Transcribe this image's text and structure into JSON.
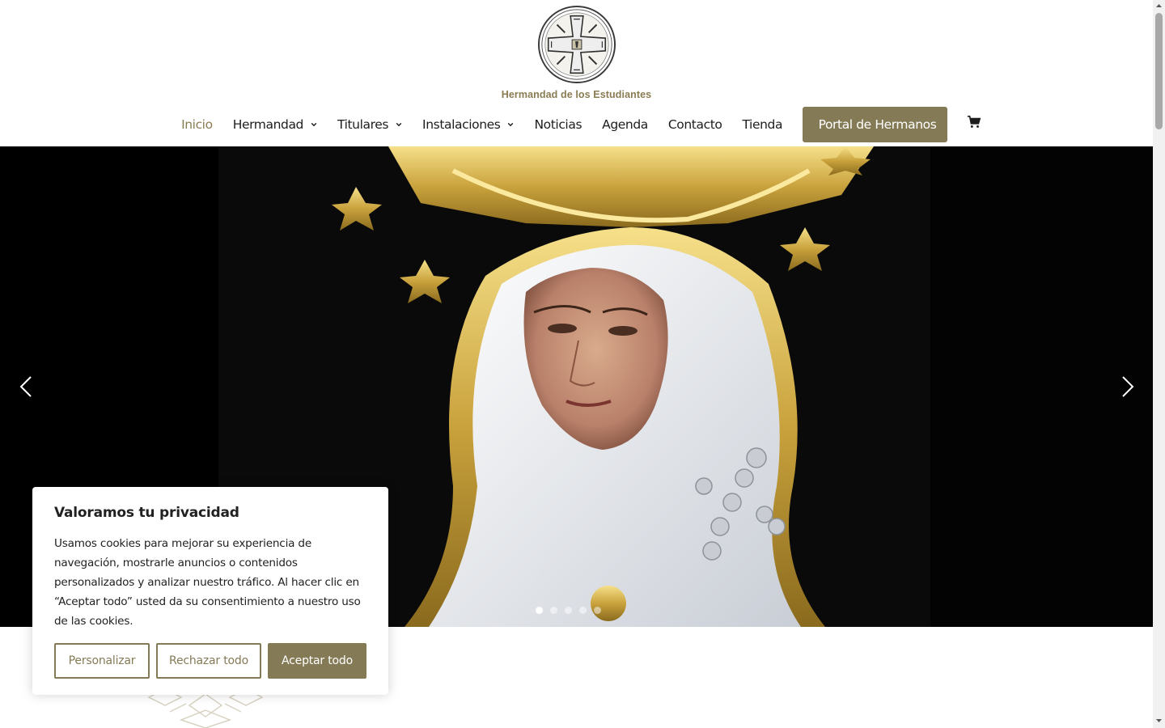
{
  "header": {
    "logo_text": "Hermandad de los Estudiantes"
  },
  "nav": {
    "items": [
      {
        "label": "Inicio",
        "active": true,
        "has_dropdown": false
      },
      {
        "label": "Hermandad",
        "active": false,
        "has_dropdown": true
      },
      {
        "label": "Titulares",
        "active": false,
        "has_dropdown": true
      },
      {
        "label": "Instalaciones",
        "active": false,
        "has_dropdown": true
      },
      {
        "label": "Noticias",
        "active": false,
        "has_dropdown": false
      },
      {
        "label": "Agenda",
        "active": false,
        "has_dropdown": false
      },
      {
        "label": "Contacto",
        "active": false,
        "has_dropdown": false
      },
      {
        "label": "Tienda",
        "active": false,
        "has_dropdown": false
      }
    ],
    "portal_button": "Portal de Hermanos",
    "cart_icon": "shopping-cart-icon"
  },
  "slider": {
    "slide_count": 5,
    "active_index": 0,
    "prev_icon": "chevron-left-icon",
    "next_icon": "chevron-right-icon"
  },
  "cookie_banner": {
    "title": "Valoramos tu privacidad",
    "text": "Usamos cookies para mejorar su experiencia de navegación, mostrarle anuncios o contenidos personalizados y analizar nuestro tráfico. Al hacer clic en “Aceptar todo” usted da su consentimiento a nuestro uso de las cookies.",
    "customize_label": "Personalizar",
    "reject_label": "Rechazar todo",
    "accept_label": "Aceptar todo"
  },
  "colors": {
    "accent": "#857a56",
    "nav_active": "#8a7c52",
    "text": "#1d1d1d",
    "slider_bg": "#060606"
  }
}
